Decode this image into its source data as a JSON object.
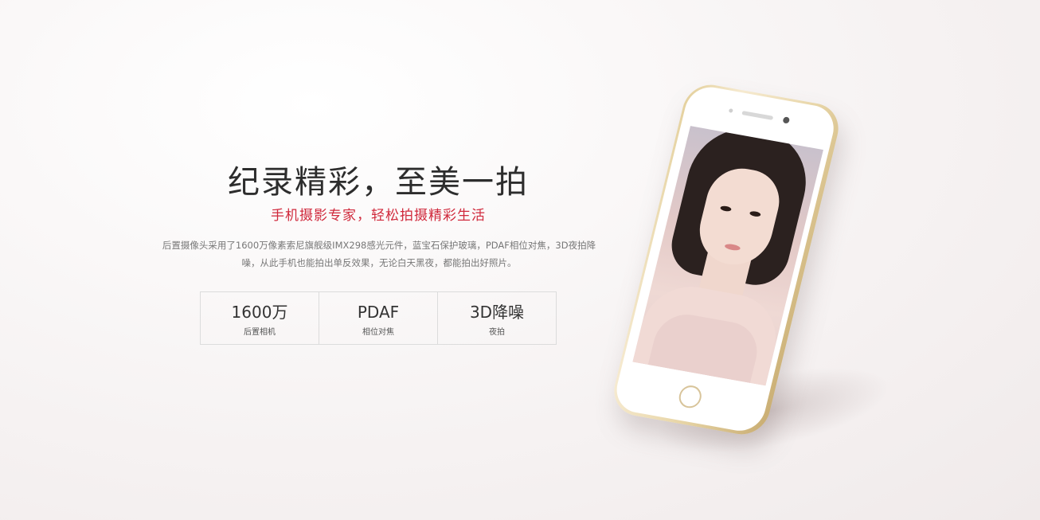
{
  "hero": {
    "title": "纪录精彩，至美一拍",
    "subtitle": "手机摄影专家，轻松拍摄精彩生活",
    "description": "后置摄像头采用了1600万像素索尼旗舰级IMX298感光元件，蓝宝石保护玻璃，PDAF相位对焦，3D夜拍降噪，从此手机也能拍出单反效果，无论白天黑夜，都能拍出好照片。"
  },
  "specs": [
    {
      "value": "1600万",
      "label": "后置相机"
    },
    {
      "value": "PDAF",
      "label": "相位对焦"
    },
    {
      "value": "3D降噪",
      "label": "夜拍"
    }
  ],
  "colors": {
    "accent": "#d0293c",
    "title": "#2d2d2d",
    "phone_gold": "#e3cf9a"
  }
}
